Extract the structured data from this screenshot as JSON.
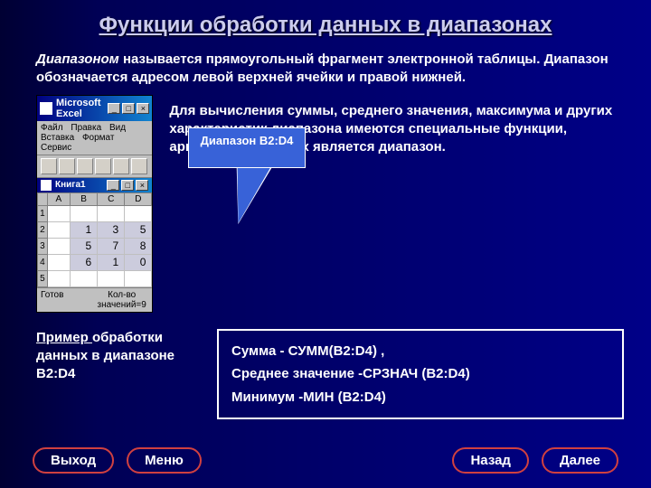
{
  "title": "Функции обработки данных в диапазонах",
  "intro": {
    "term": "Диапазоном",
    "rest": " называется прямоугольный фрагмент электронной таблицы. Диапазон обозначается адресом левой верхней ячейки и правой нижней."
  },
  "callout": "Диапазон B2:D4",
  "excel": {
    "app_title": "Microsoft Excel",
    "menu": [
      "Файл",
      "Правка",
      "Вид",
      "Вставка",
      "Формат",
      "Сервис"
    ],
    "workbook": "Книга1",
    "cols": [
      "A",
      "B",
      "C",
      "D"
    ],
    "rows": [
      {
        "n": "1",
        "cells": [
          "",
          "",
          "",
          ""
        ]
      },
      {
        "n": "2",
        "cells": [
          "",
          "1",
          "3",
          "5"
        ]
      },
      {
        "n": "3",
        "cells": [
          "",
          "5",
          "7",
          "8"
        ]
      },
      {
        "n": "4",
        "cells": [
          "",
          "6",
          "1",
          "0"
        ]
      },
      {
        "n": "5",
        "cells": [
          "",
          "",
          "",
          ""
        ]
      }
    ],
    "status_ready": "Готов",
    "status_count": "Кол-во значений=9"
  },
  "desc": "Для вычисления суммы, среднего значения, максимума и других характеристик  диапазона имеются специальные функции, аргументом которых является  диапазон.",
  "example": {
    "u": "Пример ",
    "rest": "обработки данных в диапазоне B2:D4"
  },
  "formulas": {
    "l1": "Сумма  -   СУММ(B2:D4) ,",
    "l2": "Среднее значение -СРЗНАЧ (B2:D4)",
    "l3": "Минимум -МИН (B2:D4)"
  },
  "nav": {
    "exit": "Выход",
    "menu": "Меню",
    "back": "Назад",
    "next": "Далее"
  }
}
